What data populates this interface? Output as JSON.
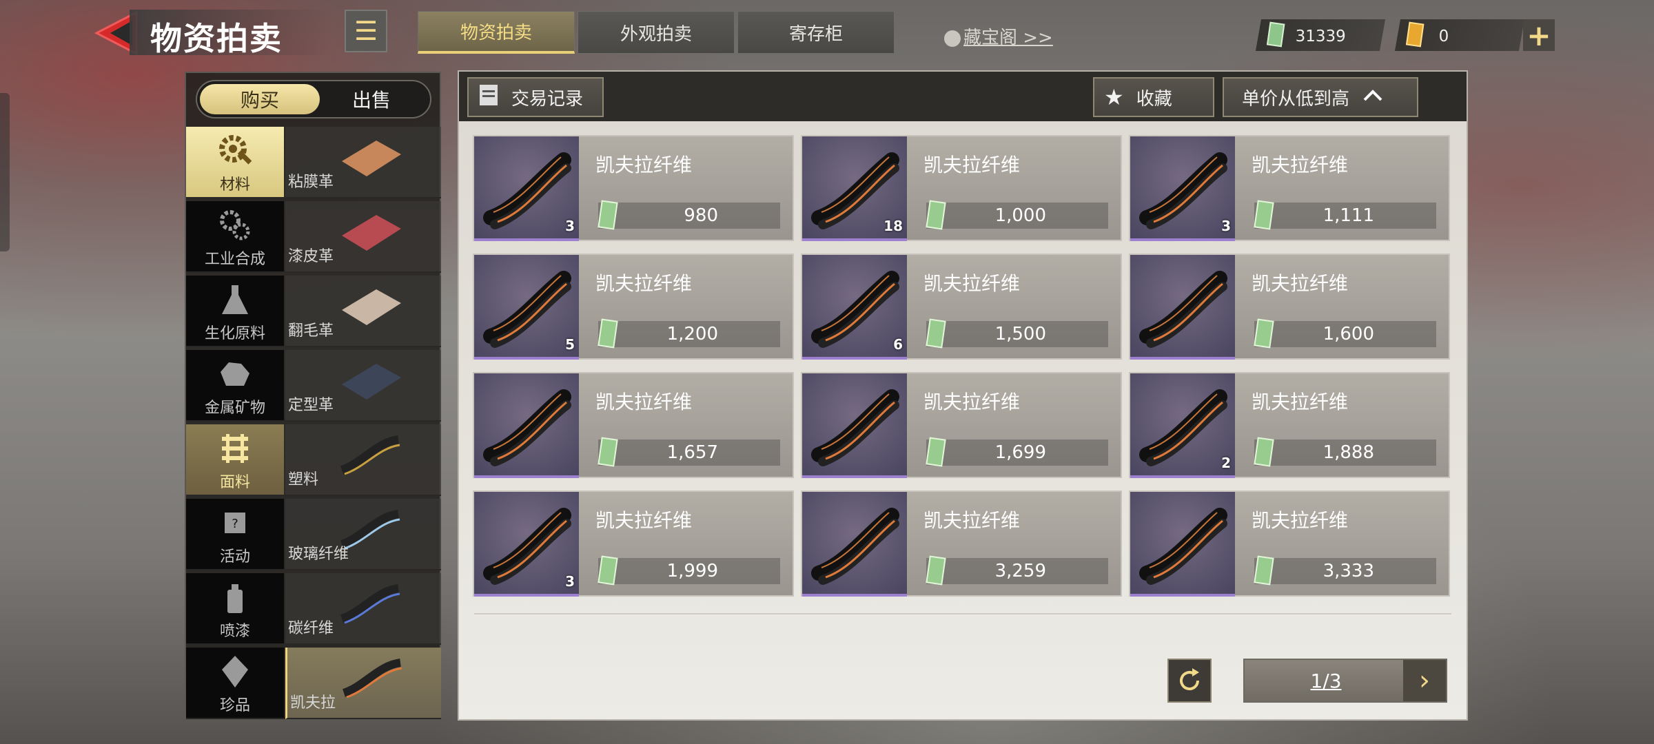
{
  "header": {
    "title": "物资拍卖",
    "menu_icon": "list-icon",
    "tabs": [
      {
        "label": "物资拍卖",
        "active": true
      },
      {
        "label": "外观拍卖",
        "active": false
      },
      {
        "label": "寄存柜",
        "active": false
      }
    ],
    "treasure_link": "藏宝阁 >>",
    "cash": "31339",
    "tickets": "0",
    "plus_label": "+"
  },
  "sidebar": {
    "segments": [
      {
        "label": "购买",
        "active": true
      },
      {
        "label": "出售",
        "active": false
      }
    ],
    "categories": [
      {
        "label": "材料",
        "icon": "gear-wrench-icon"
      },
      {
        "label": "工业合成",
        "icon": "gears-icon"
      },
      {
        "label": "生化原料",
        "icon": "flask-icon"
      },
      {
        "label": "金属矿物",
        "icon": "ore-icon"
      },
      {
        "label": "面料",
        "icon": "fabric-icon"
      },
      {
        "label": "活动",
        "icon": "chip-icon"
      },
      {
        "label": "喷漆",
        "icon": "spray-can-icon"
      },
      {
        "label": "珍品",
        "icon": "gem-icon"
      }
    ],
    "subcategories": [
      {
        "label": "粘膜革"
      },
      {
        "label": "漆皮革"
      },
      {
        "label": "翻毛革"
      },
      {
        "label": "定型革"
      },
      {
        "label": "塑料"
      },
      {
        "label": "玻璃纤维"
      },
      {
        "label": "碳纤维"
      },
      {
        "label": "凯夫拉"
      }
    ]
  },
  "main": {
    "history_label": "交易记录",
    "favorite_label": "收藏",
    "sort_label": "单价从低到高",
    "items": [
      {
        "name": "凯夫拉纤维",
        "price": "980",
        "qty": "3"
      },
      {
        "name": "凯夫拉纤维",
        "price": "1,000",
        "qty": "18"
      },
      {
        "name": "凯夫拉纤维",
        "price": "1,111",
        "qty": "3"
      },
      {
        "name": "凯夫拉纤维",
        "price": "1,200",
        "qty": "5"
      },
      {
        "name": "凯夫拉纤维",
        "price": "1,500",
        "qty": "6"
      },
      {
        "name": "凯夫拉纤维",
        "price": "1,600",
        "qty": ""
      },
      {
        "name": "凯夫拉纤维",
        "price": "1,657",
        "qty": ""
      },
      {
        "name": "凯夫拉纤维",
        "price": "1,699",
        "qty": ""
      },
      {
        "name": "凯夫拉纤维",
        "price": "1,888",
        "qty": "2"
      },
      {
        "name": "凯夫拉纤维",
        "price": "1,999",
        "qty": "3"
      },
      {
        "name": "凯夫拉纤维",
        "price": "3,259",
        "qty": ""
      },
      {
        "name": "凯夫拉纤维",
        "price": "3,333",
        "qty": ""
      }
    ],
    "page": "1/3"
  },
  "colors": {
    "accent_gold": "#f2d98a",
    "item_rarity_purple": "#9d7fd0",
    "back_red": "#d42a2a"
  }
}
